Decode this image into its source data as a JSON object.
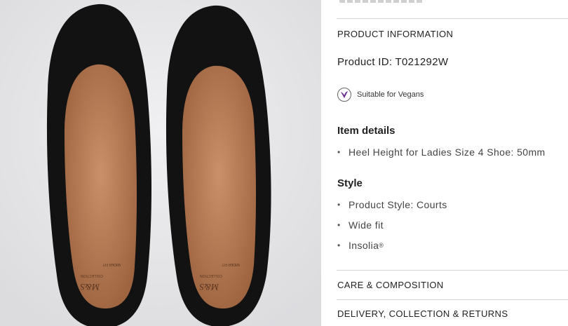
{
  "product_info": {
    "heading": "PRODUCT INFORMATION",
    "product_id": "Product ID: T021292W",
    "vegan_label": "Suitable for Vegans"
  },
  "item_details": {
    "heading": "Item details",
    "items": [
      "Heel Height for Ladies Size 4 Shoe: 50mm"
    ]
  },
  "style": {
    "heading": "Style",
    "items": [
      "Product Style: Courts",
      "Wide fit",
      "Insolia"
    ],
    "insolia_mark": "®"
  },
  "accordions": {
    "care": "CARE & COMPOSITION",
    "delivery": "DELIVERY, COLLECTION & RETURNS"
  },
  "insole_print": {
    "brand": "M&S",
    "collection": "COLLECTION",
    "fit": "WIDER FIT"
  },
  "colors": {
    "shoe": "#111111",
    "insole": "#b97d55",
    "vegan_accent": "#6a2c91"
  },
  "icons": [
    "vegan-badge-icon",
    "bullet-dot-icon"
  ]
}
